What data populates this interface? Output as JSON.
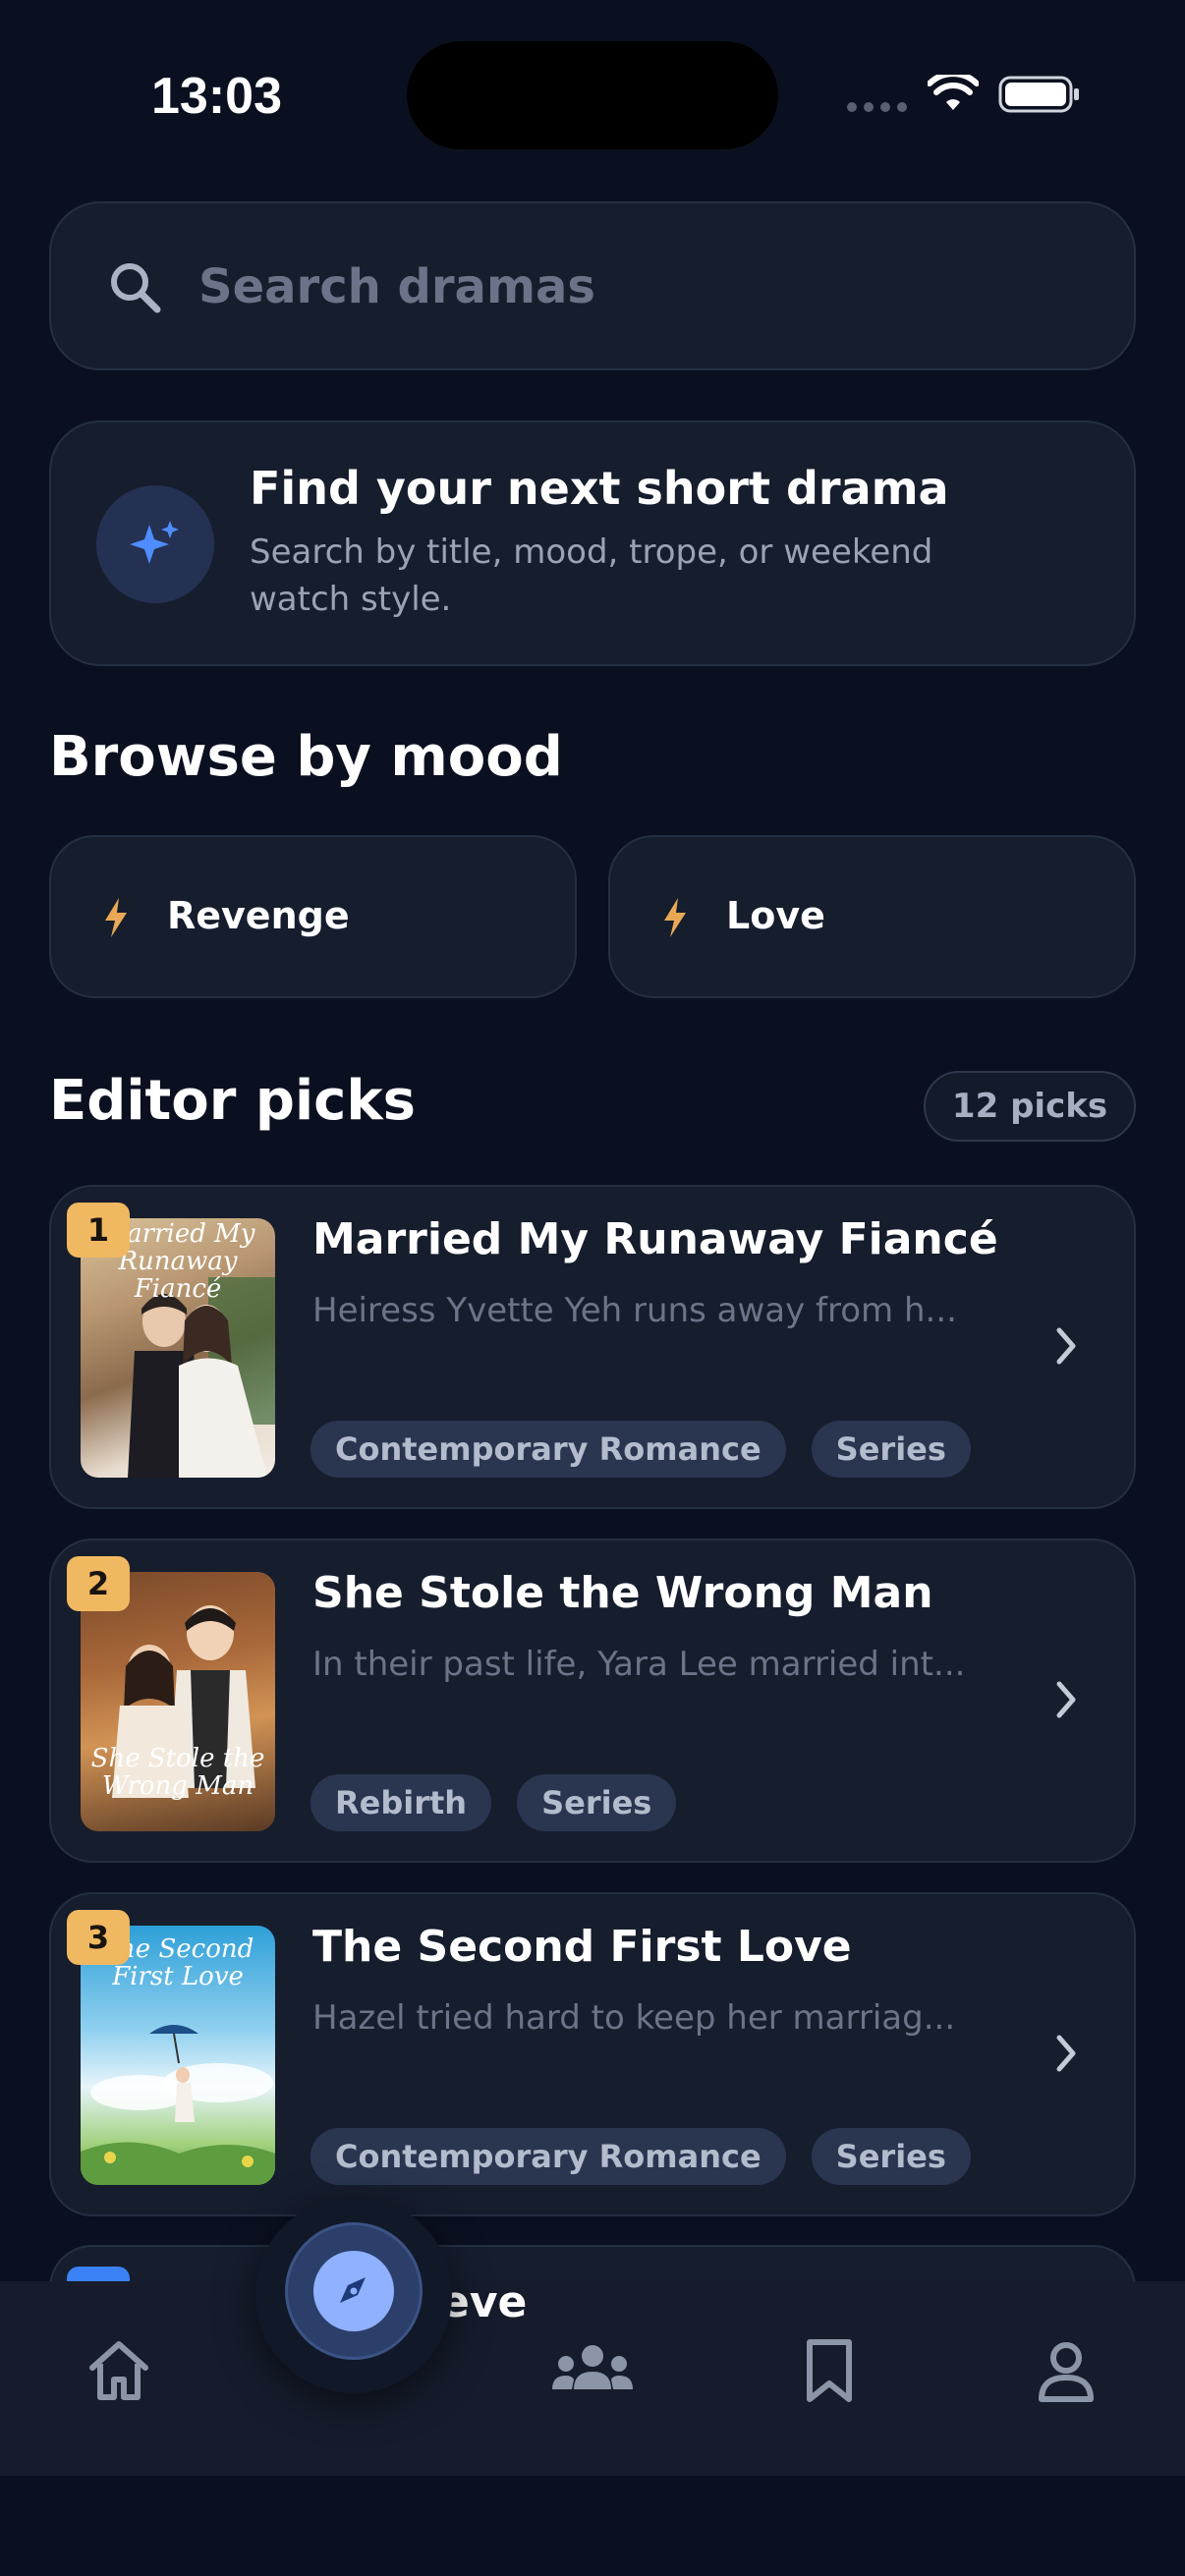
{
  "status_bar": {
    "time": "13:03"
  },
  "search": {
    "placeholder": "Search dramas"
  },
  "hero": {
    "title": "Find your next short drama",
    "subtitle": "Search by title, mood, trope, or weekend watch style.",
    "icon": "sparkles-icon"
  },
  "moods": {
    "title": "Browse by mood",
    "items": [
      {
        "label": "Revenge",
        "icon": "bolt-icon"
      },
      {
        "label": "Love",
        "icon": "bolt-icon"
      }
    ]
  },
  "picks": {
    "title": "Editor picks",
    "count_label": "12 picks",
    "items": [
      {
        "rank": "1",
        "title": "Married My Runaway Fiancé",
        "description": "Heiress Yvette Yeh runs away from h...",
        "poster_text": "Married My Runaway Fiancé",
        "tags": [
          "Contemporary Romance",
          "Series"
        ]
      },
      {
        "rank": "2",
        "title": "She Stole the Wrong Man",
        "description": "In their past life, Yara Lee married int...",
        "poster_text": "She Stole the Wrong Man",
        "tags": [
          "Rebirth",
          "Series"
        ]
      },
      {
        "rank": "3",
        "title": "The Second First Love",
        "description": "Hazel tried hard to keep her marriag...",
        "poster_text": "The Second First Love",
        "tags": [
          "Contemporary Romance",
          "Series"
        ]
      }
    ],
    "partial_title": "eve"
  },
  "tab_bar": {
    "items": [
      {
        "icon": "home-icon"
      },
      {
        "icon": "compass-icon"
      },
      {
        "icon": "community-icon"
      },
      {
        "icon": "bookmark-icon"
      },
      {
        "icon": "profile-icon"
      }
    ]
  },
  "colors": {
    "background": "#0b1020",
    "card": "#161d2d",
    "accent_gold": "#f0b860",
    "accent_blue": "#8fb1ff"
  }
}
